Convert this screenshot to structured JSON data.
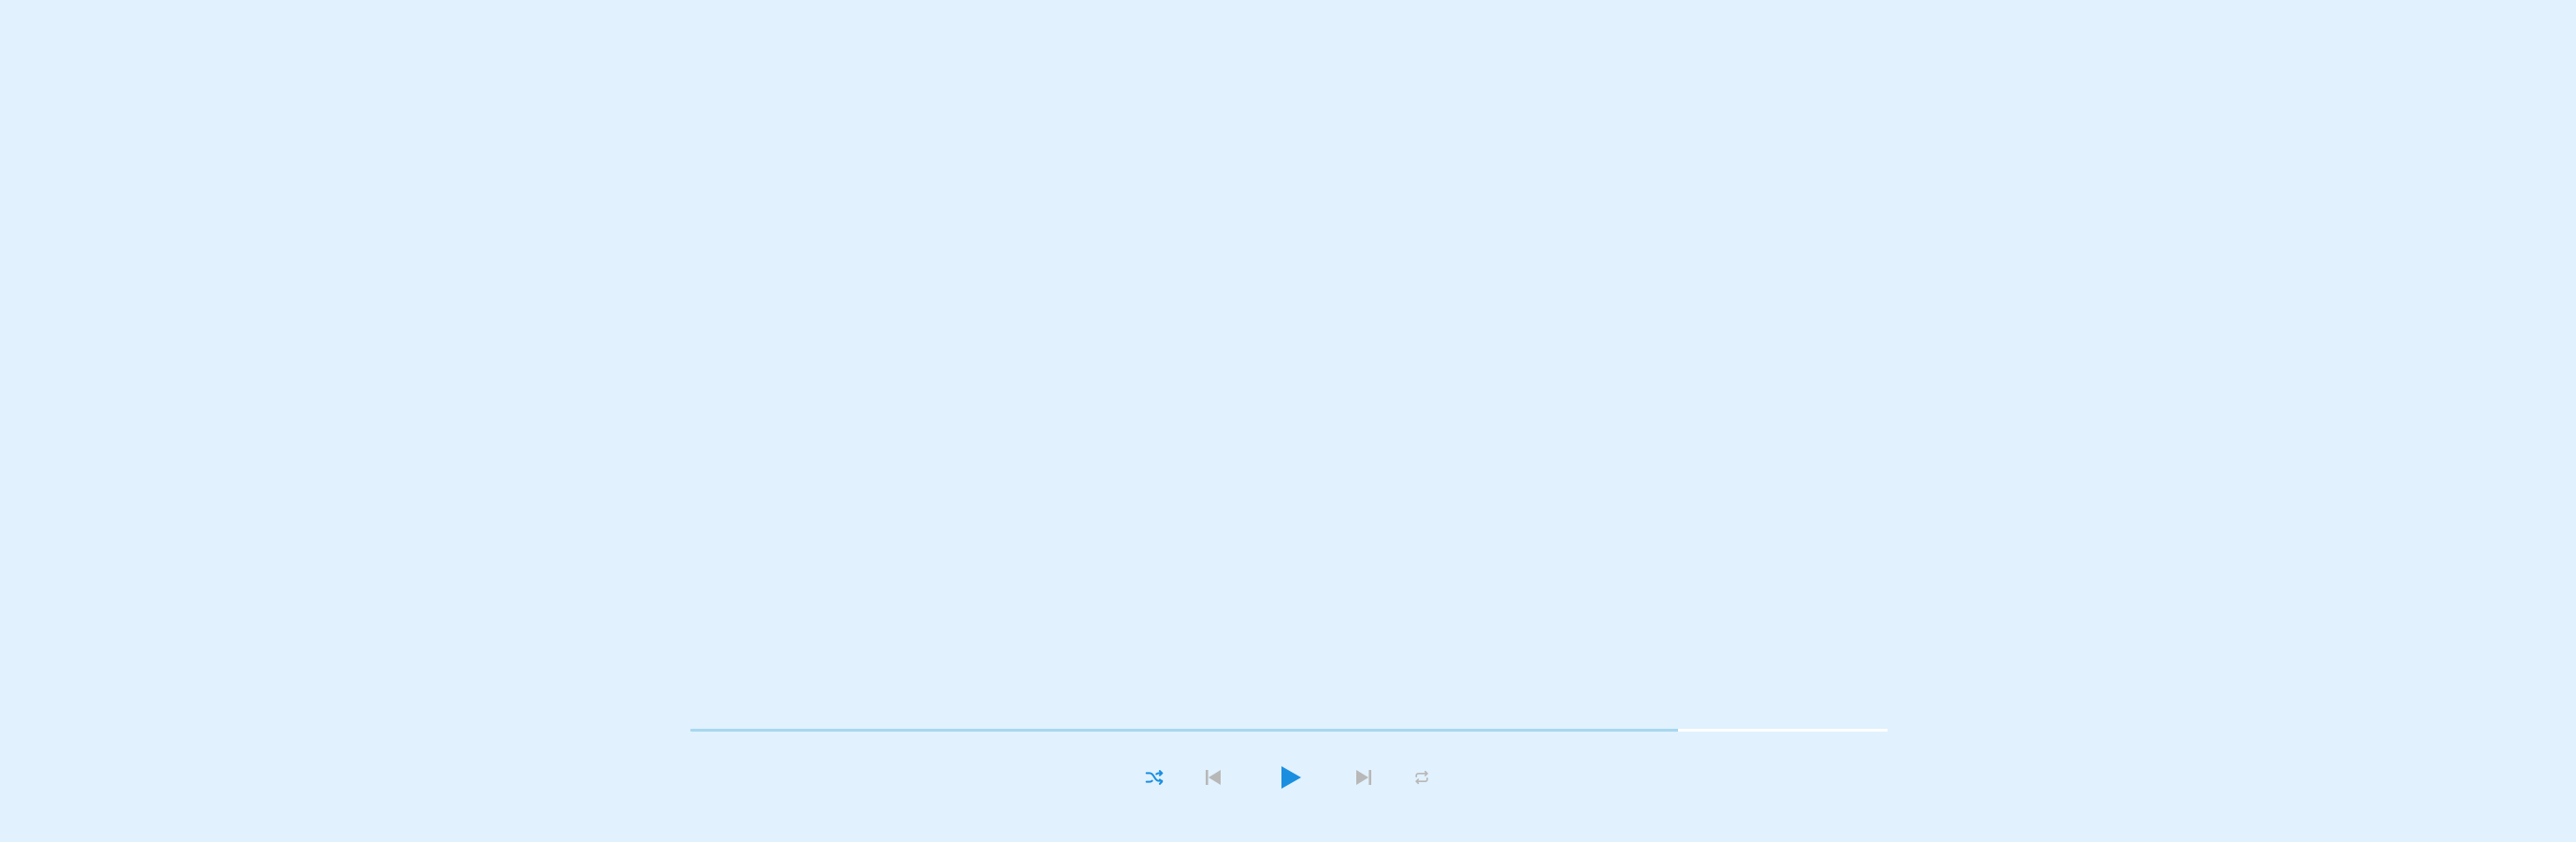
{
  "player": {
    "progress_fraction": 0.825,
    "progress_color": "#a7d8ee",
    "track_color": "#ffffff",
    "background": "#e1f1fe"
  },
  "controls": {
    "shuffle": {
      "icon": "shuffle-icon",
      "color": "#1a8fe0",
      "active": true
    },
    "previous": {
      "icon": "skip-previous-icon",
      "color": "#b8b8b8"
    },
    "play": {
      "icon": "play-icon",
      "color": "#1a8fe0"
    },
    "next": {
      "icon": "skip-next-icon",
      "color": "#b8b8b8"
    },
    "repeat": {
      "icon": "repeat-icon",
      "color": "#b8b8b8",
      "active": false
    }
  }
}
